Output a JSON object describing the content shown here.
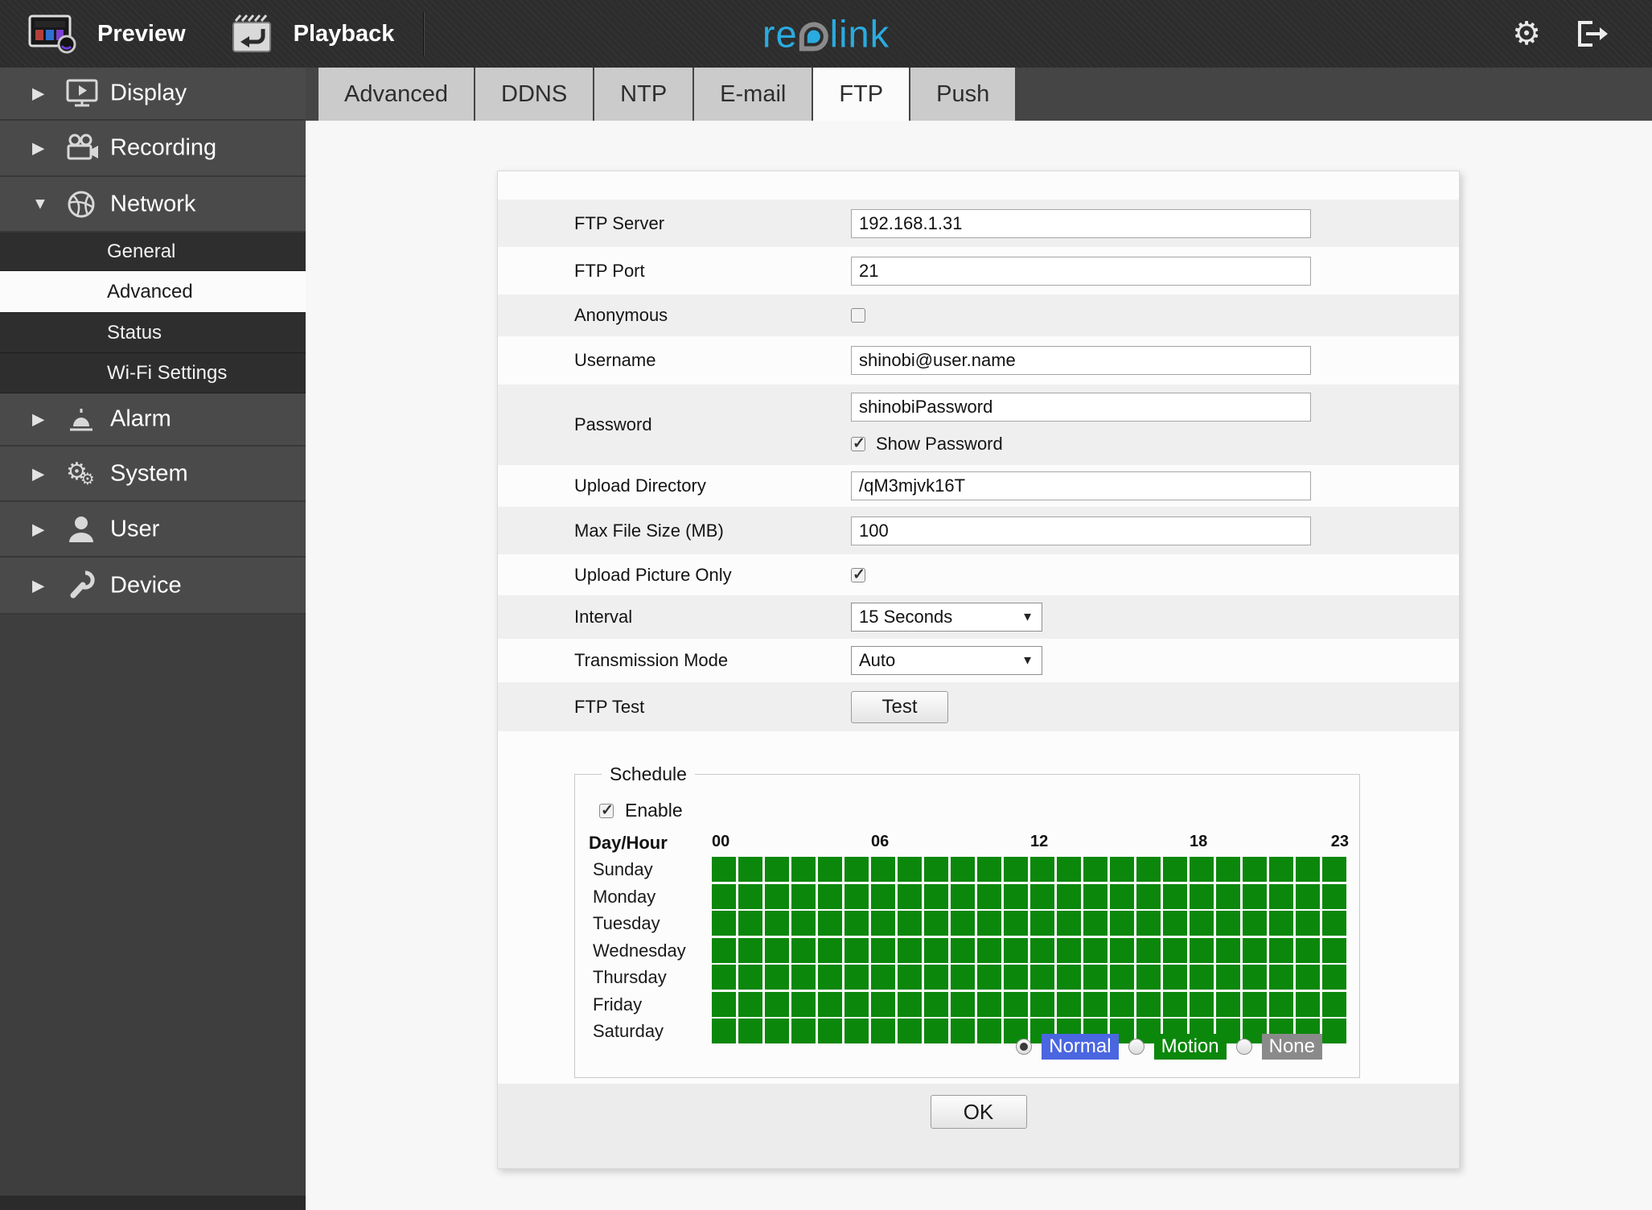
{
  "topbar": {
    "preview_label": "Preview",
    "playback_label": "Playback",
    "logo": {
      "part1": "re",
      "part2": "link",
      "blue": "#2aabdf",
      "gray": "#8a8a8a"
    }
  },
  "tabs": {
    "active": "FTP",
    "items": [
      {
        "label": "Advanced"
      },
      {
        "label": "DDNS"
      },
      {
        "label": "NTP"
      },
      {
        "label": "E-mail"
      },
      {
        "label": "FTP"
      },
      {
        "label": "Push"
      }
    ]
  },
  "sidebar": {
    "items": [
      {
        "label": "Display",
        "expanded": false
      },
      {
        "label": "Recording",
        "expanded": false
      },
      {
        "label": "Network",
        "expanded": true,
        "children": [
          {
            "label": "General",
            "selected": false
          },
          {
            "label": "Advanced",
            "selected": true
          },
          {
            "label": "Status",
            "selected": false
          },
          {
            "label": "Wi-Fi Settings",
            "selected": false
          }
        ]
      },
      {
        "label": "Alarm",
        "expanded": false
      },
      {
        "label": "System",
        "expanded": false
      },
      {
        "label": "User",
        "expanded": false
      },
      {
        "label": "Device",
        "expanded": false
      }
    ]
  },
  "form": {
    "ftp_server": {
      "label": "FTP Server",
      "value": "192.168.1.31"
    },
    "ftp_port": {
      "label": "FTP Port",
      "value": "21"
    },
    "anonymous": {
      "label": "Anonymous",
      "checked": false
    },
    "username": {
      "label": "Username",
      "value": "shinobi@user.name"
    },
    "password": {
      "label": "Password",
      "value": "shinobiPassword",
      "show_password_label": "Show Password",
      "show_password_checked": true
    },
    "upload_directory": {
      "label": "Upload Directory",
      "value": "/qM3mjvk16T"
    },
    "max_file_size": {
      "label": "Max File Size (MB)",
      "value": "100"
    },
    "upload_picture_only": {
      "label": "Upload Picture Only",
      "checked": true
    },
    "interval": {
      "label": "Interval",
      "value": "15 Seconds"
    },
    "transmission_mode": {
      "label": "Transmission Mode",
      "value": "Auto"
    },
    "ftp_test": {
      "label": "FTP Test",
      "button_label": "Test"
    }
  },
  "schedule": {
    "legend": "Schedule",
    "enable_label": "Enable",
    "enabled": true,
    "day_hour_label": "Day/Hour",
    "hour_labels": [
      "00",
      "06",
      "12",
      "18",
      "23"
    ],
    "days": [
      "Sunday",
      "Monday",
      "Tuesday",
      "Wednesday",
      "Thursday",
      "Friday",
      "Saturday"
    ],
    "grid": {
      "columns": 24,
      "rows": 7,
      "fill": "all",
      "fill_state": "motion",
      "fill_color": "#0b870b"
    },
    "modes": [
      {
        "label": "Normal",
        "color": "#4a66e0",
        "selected": true
      },
      {
        "label": "Motion",
        "color": "#0b870b",
        "selected": false
      },
      {
        "label": "None",
        "color": "#8a8a8a",
        "selected": false
      }
    ]
  },
  "footer": {
    "ok_label": "OK"
  }
}
